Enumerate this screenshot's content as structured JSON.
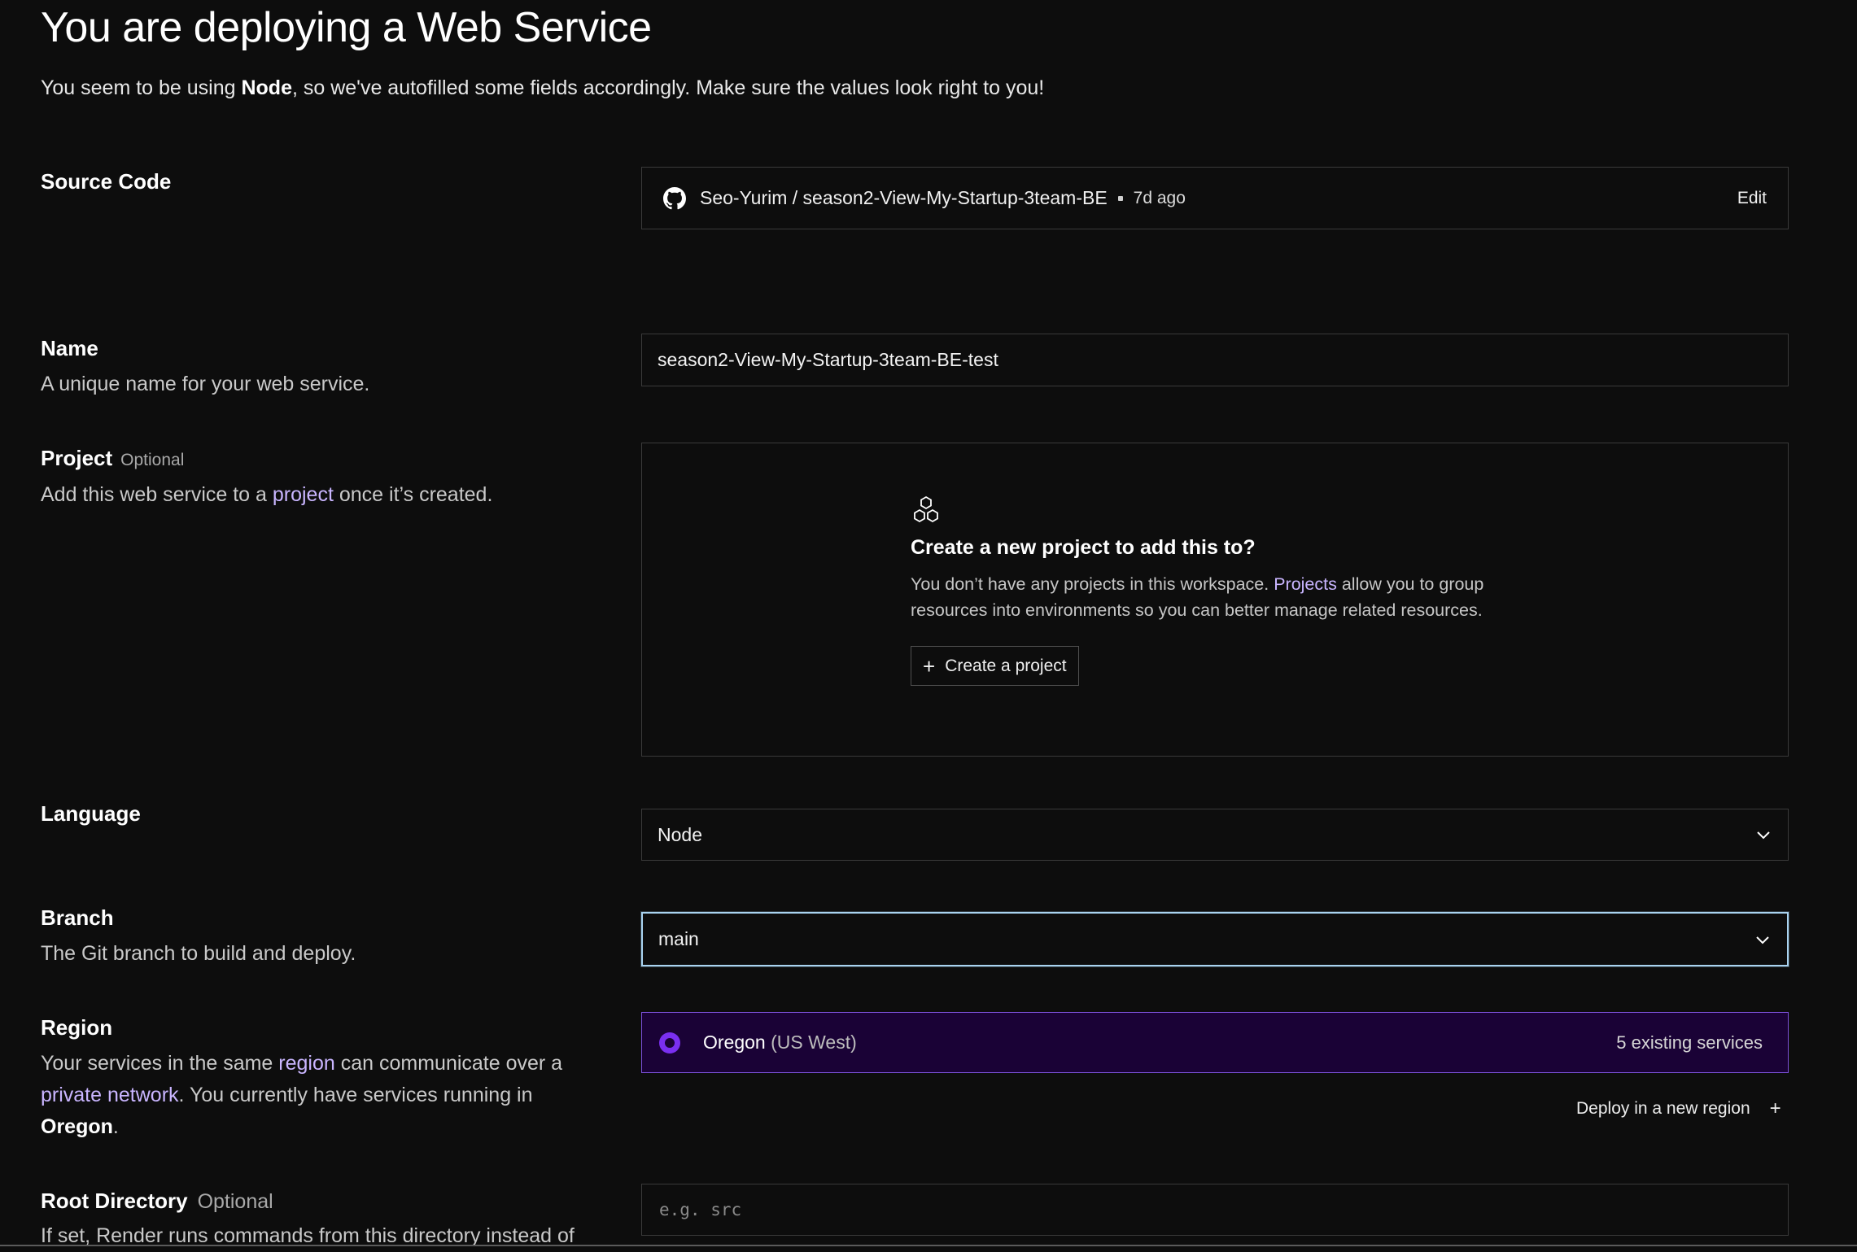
{
  "header": {
    "title": "You are deploying a Web Service",
    "subtitle_prefix": "You seem to be using ",
    "subtitle_language": "Node",
    "subtitle_suffix": ", so we've autofilled some fields accordingly. Make sure the values look right to you!"
  },
  "source_code": {
    "label": "Source Code",
    "repo": "Seo-Yurim / season2-View-My-Startup-3team-BE",
    "updated": "7d ago",
    "edit_label": "Edit",
    "icon": "github-icon"
  },
  "name": {
    "label": "Name",
    "description": "A unique name for your web service.",
    "value": "season2-View-My-Startup-3team-BE-test"
  },
  "project": {
    "label": "Project",
    "optional": "Optional",
    "desc_prefix": "Add this web service to a ",
    "desc_link": "project",
    "desc_suffix": " once it’s created.",
    "empty_title": "Create a new project to add this to?",
    "empty_text_prefix": "You don’t have any projects in this workspace. ",
    "empty_text_link": "Projects",
    "empty_text_suffix": " allow you to group resources into environments so you can better manage related resources.",
    "create_button": "Create a project",
    "icon": "project-hexagons-icon"
  },
  "language": {
    "label": "Language",
    "selected": "Node"
  },
  "branch": {
    "label": "Branch",
    "description": "The Git branch to build and deploy.",
    "selected": "main"
  },
  "region": {
    "label": "Region",
    "desc_1": "Your services in the same ",
    "desc_link_1": "region",
    "desc_2": " can communicate over a ",
    "desc_link_2": "private network",
    "desc_3": ". You currently have services running in ",
    "desc_bold": "Oregon",
    "desc_4": ".",
    "selected_name": "Oregon",
    "selected_detail": " (US West)",
    "existing_services": "5 existing services",
    "deploy_new_label": "Deploy in a new region",
    "accent_color": "#7a2ff0",
    "card_background": "#1a0236"
  },
  "root_directory": {
    "label": "Root Directory",
    "optional": "Optional",
    "placeholder": "e.g. src",
    "description": "If set, Render runs commands from this directory instead of"
  },
  "colors": {
    "background": "#0d0d0d",
    "link": "#c9b5ff",
    "focus_border": "#a9d3f0"
  }
}
